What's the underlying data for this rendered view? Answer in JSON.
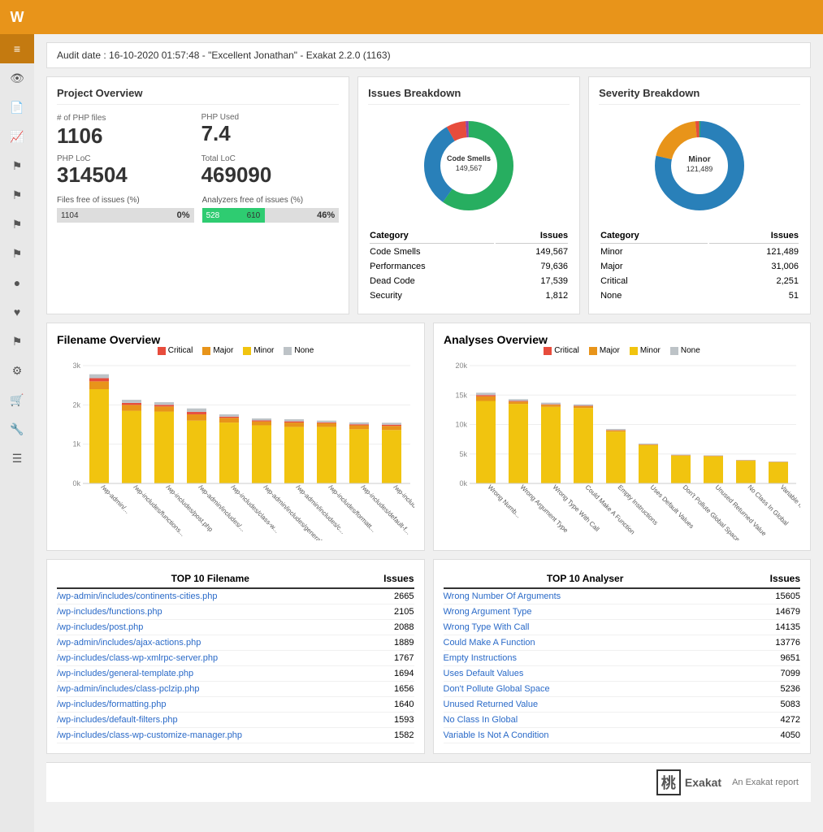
{
  "topbar": {
    "logo": "W",
    "menu_icon": "≡"
  },
  "audit": {
    "label": "Audit date : 16-10-2020 01:57:48 - \"Excellent Jonathan\" - Exakat 2.2.0 (1163)"
  },
  "project_overview": {
    "title": "Project Overview",
    "php_files_label": "# of PHP files",
    "php_files_value": "1106",
    "php_used_label": "PHP Used",
    "php_used_value": "7.4",
    "php_loc_label": "PHP LoC",
    "php_loc_value": "314504",
    "total_loc_label": "Total LoC",
    "total_loc_value": "469090",
    "files_free_label": "Files free of issues (%)",
    "files_free_count": "1104",
    "files_free_pct": "0%",
    "analyzers_free_label": "Analyzers free of issues (%)",
    "analyzers_free_count": "528",
    "analyzers_free_total": "610",
    "analyzers_free_pct": "46%"
  },
  "issues_breakdown": {
    "title": "Issues Breakdown",
    "donut_center": "Code Smells\n149,567",
    "categories": [
      {
        "name": "Code Smells",
        "value": 149567
      },
      {
        "name": "Performances",
        "value": 79636
      },
      {
        "name": "Dead Code",
        "value": 17539
      },
      {
        "name": "Security",
        "value": 1812
      }
    ],
    "col_category": "Category",
    "col_issues": "Issues"
  },
  "severity_breakdown": {
    "title": "Severity Breakdown",
    "donut_center": "Minor\n121,489",
    "categories": [
      {
        "name": "Minor",
        "value": 121489
      },
      {
        "name": "Major",
        "value": 31006
      },
      {
        "name": "Critical",
        "value": 2251
      },
      {
        "name": "None",
        "value": 51
      }
    ],
    "col_category": "Category",
    "col_issues": "Issues"
  },
  "filename_overview": {
    "title": "Filename Overview",
    "legend": [
      "Critical",
      "Major",
      "Minor",
      "None"
    ],
    "colors": {
      "critical": "#e74c3c",
      "major": "#e8941a",
      "minor": "#f1c40f",
      "none": "#bdc3c7"
    },
    "bars": [
      {
        "label": "/wp-admin/...",
        "critical": 80,
        "major": 200,
        "minor": 2400,
        "none": 100
      },
      {
        "label": "/wp-includes/functions...",
        "critical": 50,
        "major": 150,
        "minor": 1850,
        "none": 80
      },
      {
        "label": "/wp-includes/post.php",
        "critical": 40,
        "major": 130,
        "minor": 1830,
        "none": 70
      },
      {
        "label": "/wp-admin/includes/...",
        "critical": 60,
        "major": 160,
        "minor": 1600,
        "none": 90
      },
      {
        "label": "/wp-includes/class-w...",
        "critical": 30,
        "major": 120,
        "minor": 1550,
        "none": 60
      },
      {
        "label": "/wp-admin/includes/general...",
        "critical": 25,
        "major": 100,
        "minor": 1480,
        "none": 50
      },
      {
        "label": "/wp-admin/includes/c...",
        "critical": 30,
        "major": 110,
        "minor": 1440,
        "none": 55
      },
      {
        "label": "/wp-includes/formatt...",
        "critical": 20,
        "major": 95,
        "minor": 1440,
        "none": 45
      },
      {
        "label": "/wp-includes/default-f...",
        "critical": 25,
        "major": 100,
        "minor": 1380,
        "none": 50
      },
      {
        "label": "/wp-includes/class-w...",
        "critical": 30,
        "major": 105,
        "minor": 1360,
        "none": 50
      }
    ]
  },
  "analyses_overview": {
    "title": "Analyses Overview",
    "legend": [
      "Critical",
      "Major",
      "Minor",
      "None"
    ],
    "colors": {
      "critical": "#e74c3c",
      "major": "#e8941a",
      "minor": "#f1c40f",
      "none": "#bdc3c7"
    },
    "bars": [
      {
        "label": "Wrong Numb...",
        "critical": 200,
        "major": 800,
        "minor": 14000,
        "none": 400
      },
      {
        "label": "Wrong Argument Type",
        "critical": 100,
        "major": 400,
        "minor": 13500,
        "none": 300
      },
      {
        "label": "Wrong Type With Call",
        "critical": 80,
        "major": 350,
        "minor": 13000,
        "none": 280
      },
      {
        "label": "Could Make A Function",
        "critical": 70,
        "major": 300,
        "minor": 12800,
        "none": 250
      },
      {
        "label": "Empty Instructions",
        "critical": 50,
        "major": 200,
        "minor": 8800,
        "none": 200
      },
      {
        "label": "Uses Default Values",
        "critical": 30,
        "major": 100,
        "minor": 6500,
        "none": 150
      },
      {
        "label": "Don't Pollute Global Space",
        "critical": 20,
        "major": 80,
        "minor": 4700,
        "none": 100
      },
      {
        "label": "Unused Returned Value",
        "critical": 15,
        "major": 70,
        "minor": 4600,
        "none": 90
      },
      {
        "label": "No Class In Global",
        "critical": 10,
        "major": 60,
        "minor": 3850,
        "none": 80
      },
      {
        "label": "Variable Is Not A Condition",
        "critical": 8,
        "major": 50,
        "minor": 3600,
        "none": 70
      }
    ]
  },
  "top10_filename": {
    "title": "TOP 10 Filename",
    "col_issues": "Issues",
    "rows": [
      {
        "name": "/wp-admin/includes/continents-cities.php",
        "value": "2665"
      },
      {
        "name": "/wp-includes/functions.php",
        "value": "2105"
      },
      {
        "name": "/wp-includes/post.php",
        "value": "2088"
      },
      {
        "name": "/wp-admin/includes/ajax-actions.php",
        "value": "1889"
      },
      {
        "name": "/wp-includes/class-wp-xmlrpc-server.php",
        "value": "1767"
      },
      {
        "name": "/wp-includes/general-template.php",
        "value": "1694"
      },
      {
        "name": "/wp-admin/includes/class-pclzip.php",
        "value": "1656"
      },
      {
        "name": "/wp-includes/formatting.php",
        "value": "1640"
      },
      {
        "name": "/wp-includes/default-filters.php",
        "value": "1593"
      },
      {
        "name": "/wp-includes/class-wp-customize-manager.php",
        "value": "1582"
      }
    ]
  },
  "top10_analyser": {
    "title": "TOP 10 Analyser",
    "col_issues": "Issues",
    "rows": [
      {
        "name": "Wrong Number Of Arguments",
        "value": "15605"
      },
      {
        "name": "Wrong Argument Type",
        "value": "14679"
      },
      {
        "name": "Wrong Type With Call",
        "value": "14135"
      },
      {
        "name": "Could Make A Function",
        "value": "13776"
      },
      {
        "name": "Empty Instructions",
        "value": "9651"
      },
      {
        "name": "Uses Default Values",
        "value": "7099"
      },
      {
        "name": "Don't Pollute Global Space",
        "value": "5236"
      },
      {
        "name": "Unused Returned Value",
        "value": "5083"
      },
      {
        "name": "No Class In Global",
        "value": "4272"
      },
      {
        "name": "Variable Is Not A Condition",
        "value": "4050"
      }
    ]
  },
  "footer": {
    "brand": "Exakat",
    "tagline": "An Exakat report"
  },
  "sidebar": {
    "icons": [
      "👁",
      "📄",
      "📈",
      "🚩",
      "🚩",
      "🚩",
      "🚩",
      "⚙",
      "❤",
      "🚩",
      "≡",
      "🛒",
      "🔧",
      "☰"
    ]
  }
}
